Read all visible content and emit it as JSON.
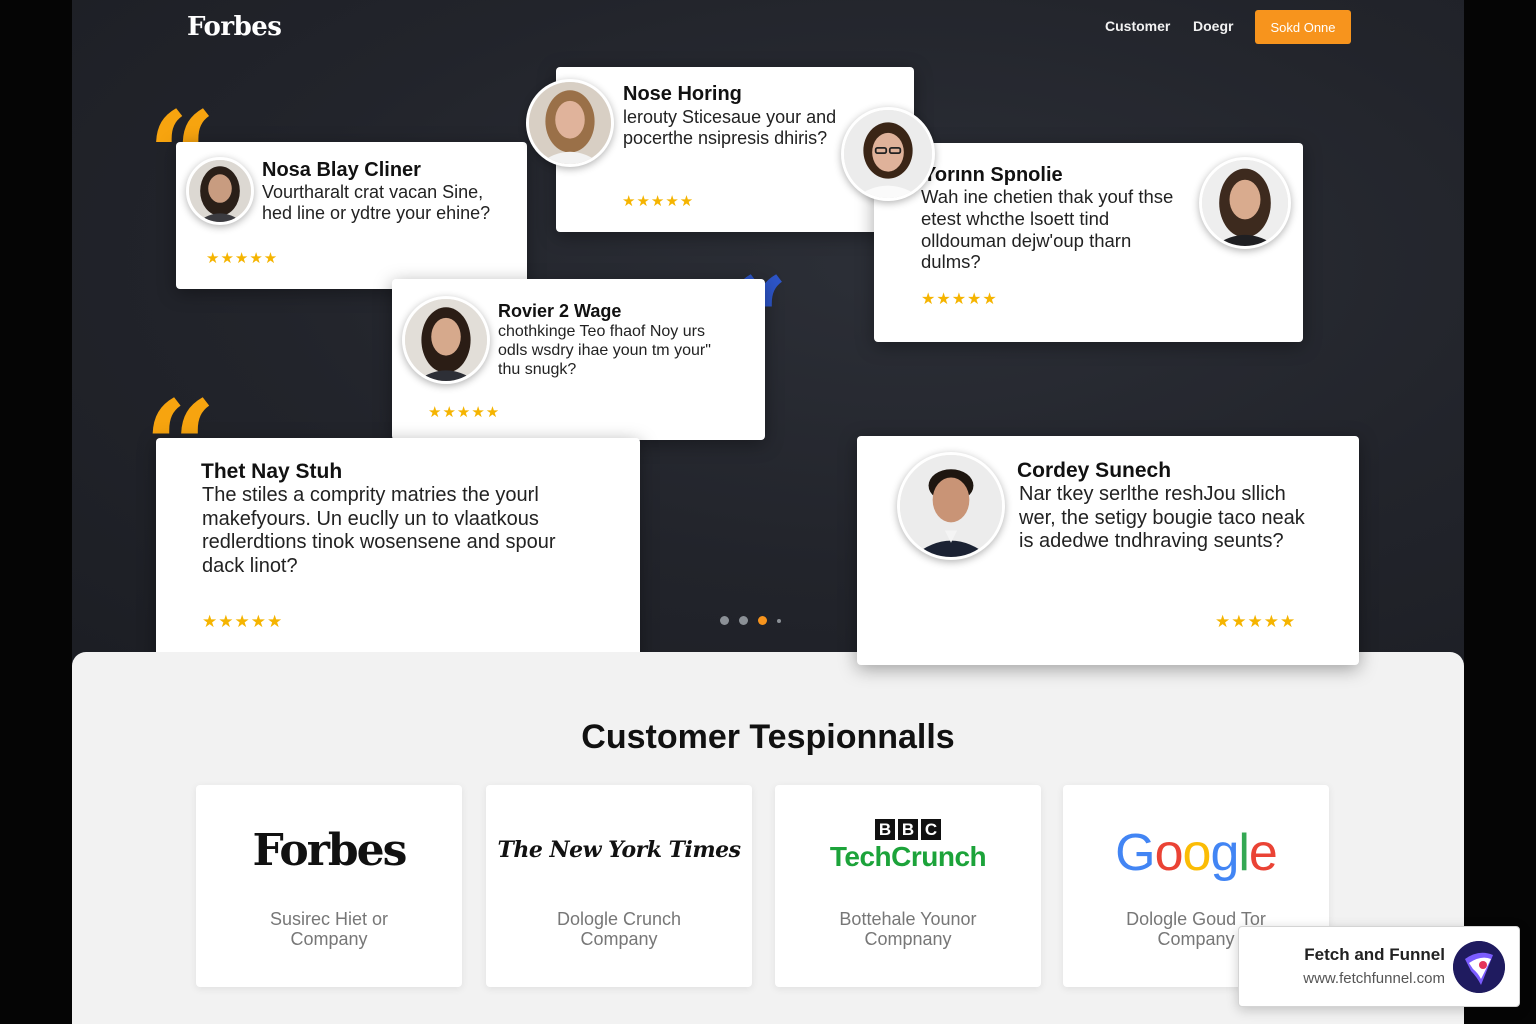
{
  "header": {
    "logo": "Forbes",
    "nav": [
      "Customer",
      "Doegr"
    ],
    "cta": "Sokd Onne"
  },
  "testimonials": [
    {
      "name": "Nosa Blay Cliner",
      "text": "Vourtharalt crat vacan Sine, hed line or ydtre your ehine?",
      "stars": "★★★★★"
    },
    {
      "name": "Nose Horing",
      "text": "lerouty Sticesaue your and pocerthe nsipresis dhiris?",
      "stars": "★★★★★"
    },
    {
      "name": "Yorınn Spnolie",
      "text": "Wah ine chetien thak youf thse etest whcthe lsoett tind olldouman dejw'oup tharn dulms?",
      "stars": "★★★★★"
    },
    {
      "name": "Rovier 2 Wage",
      "text": "chothkinge Teo fhaof Noy urs odls wsdry ihae youn tm your\" thu snugk?",
      "stars": "★★★★★"
    },
    {
      "name": "Thet Nay Stuh",
      "text": "The stiles a comprity matries the yourl makefyours. Un euclly un to vlaatkous redlerdtions tinok wosensene and spour dack linot?",
      "stars": "★★★★★"
    },
    {
      "name": "Cordey Sunech",
      "text": "Nar tkey serlthe reshJou sllich wer, the setigy bougie taco neak is adedwe tndhraving seunts?",
      "stars": "★★★★★"
    }
  ],
  "section": {
    "title": "Customer Tespionnalls"
  },
  "logos": [
    {
      "brand": "Forbes",
      "sub_line1": "Susirec Hiet or",
      "sub_line2": "Company"
    },
    {
      "brand": "The New York Times",
      "sub_line1": "Dologle Crunch",
      "sub_line2": "Company"
    },
    {
      "brand_top": "BBC",
      "brand": "TechCrunch",
      "sub_line1": "Bottehale Younor",
      "sub_line2": "Compnany"
    },
    {
      "brand": "Google",
      "sub_line1": "Dologle Goud Tor",
      "sub_line2": "Company"
    }
  ],
  "badge": {
    "title": "Fetch and Funnel",
    "url": "www.fetchfunnel.com"
  },
  "colors": {
    "accent": "#f7941d",
    "star": "#f5b400",
    "quote_blue": "#2d55c8",
    "techcrunch_green": "#1ca33a"
  },
  "icons": [
    "quote-mark-icon",
    "star-icon",
    "fetch-funnel-logo-icon"
  ]
}
